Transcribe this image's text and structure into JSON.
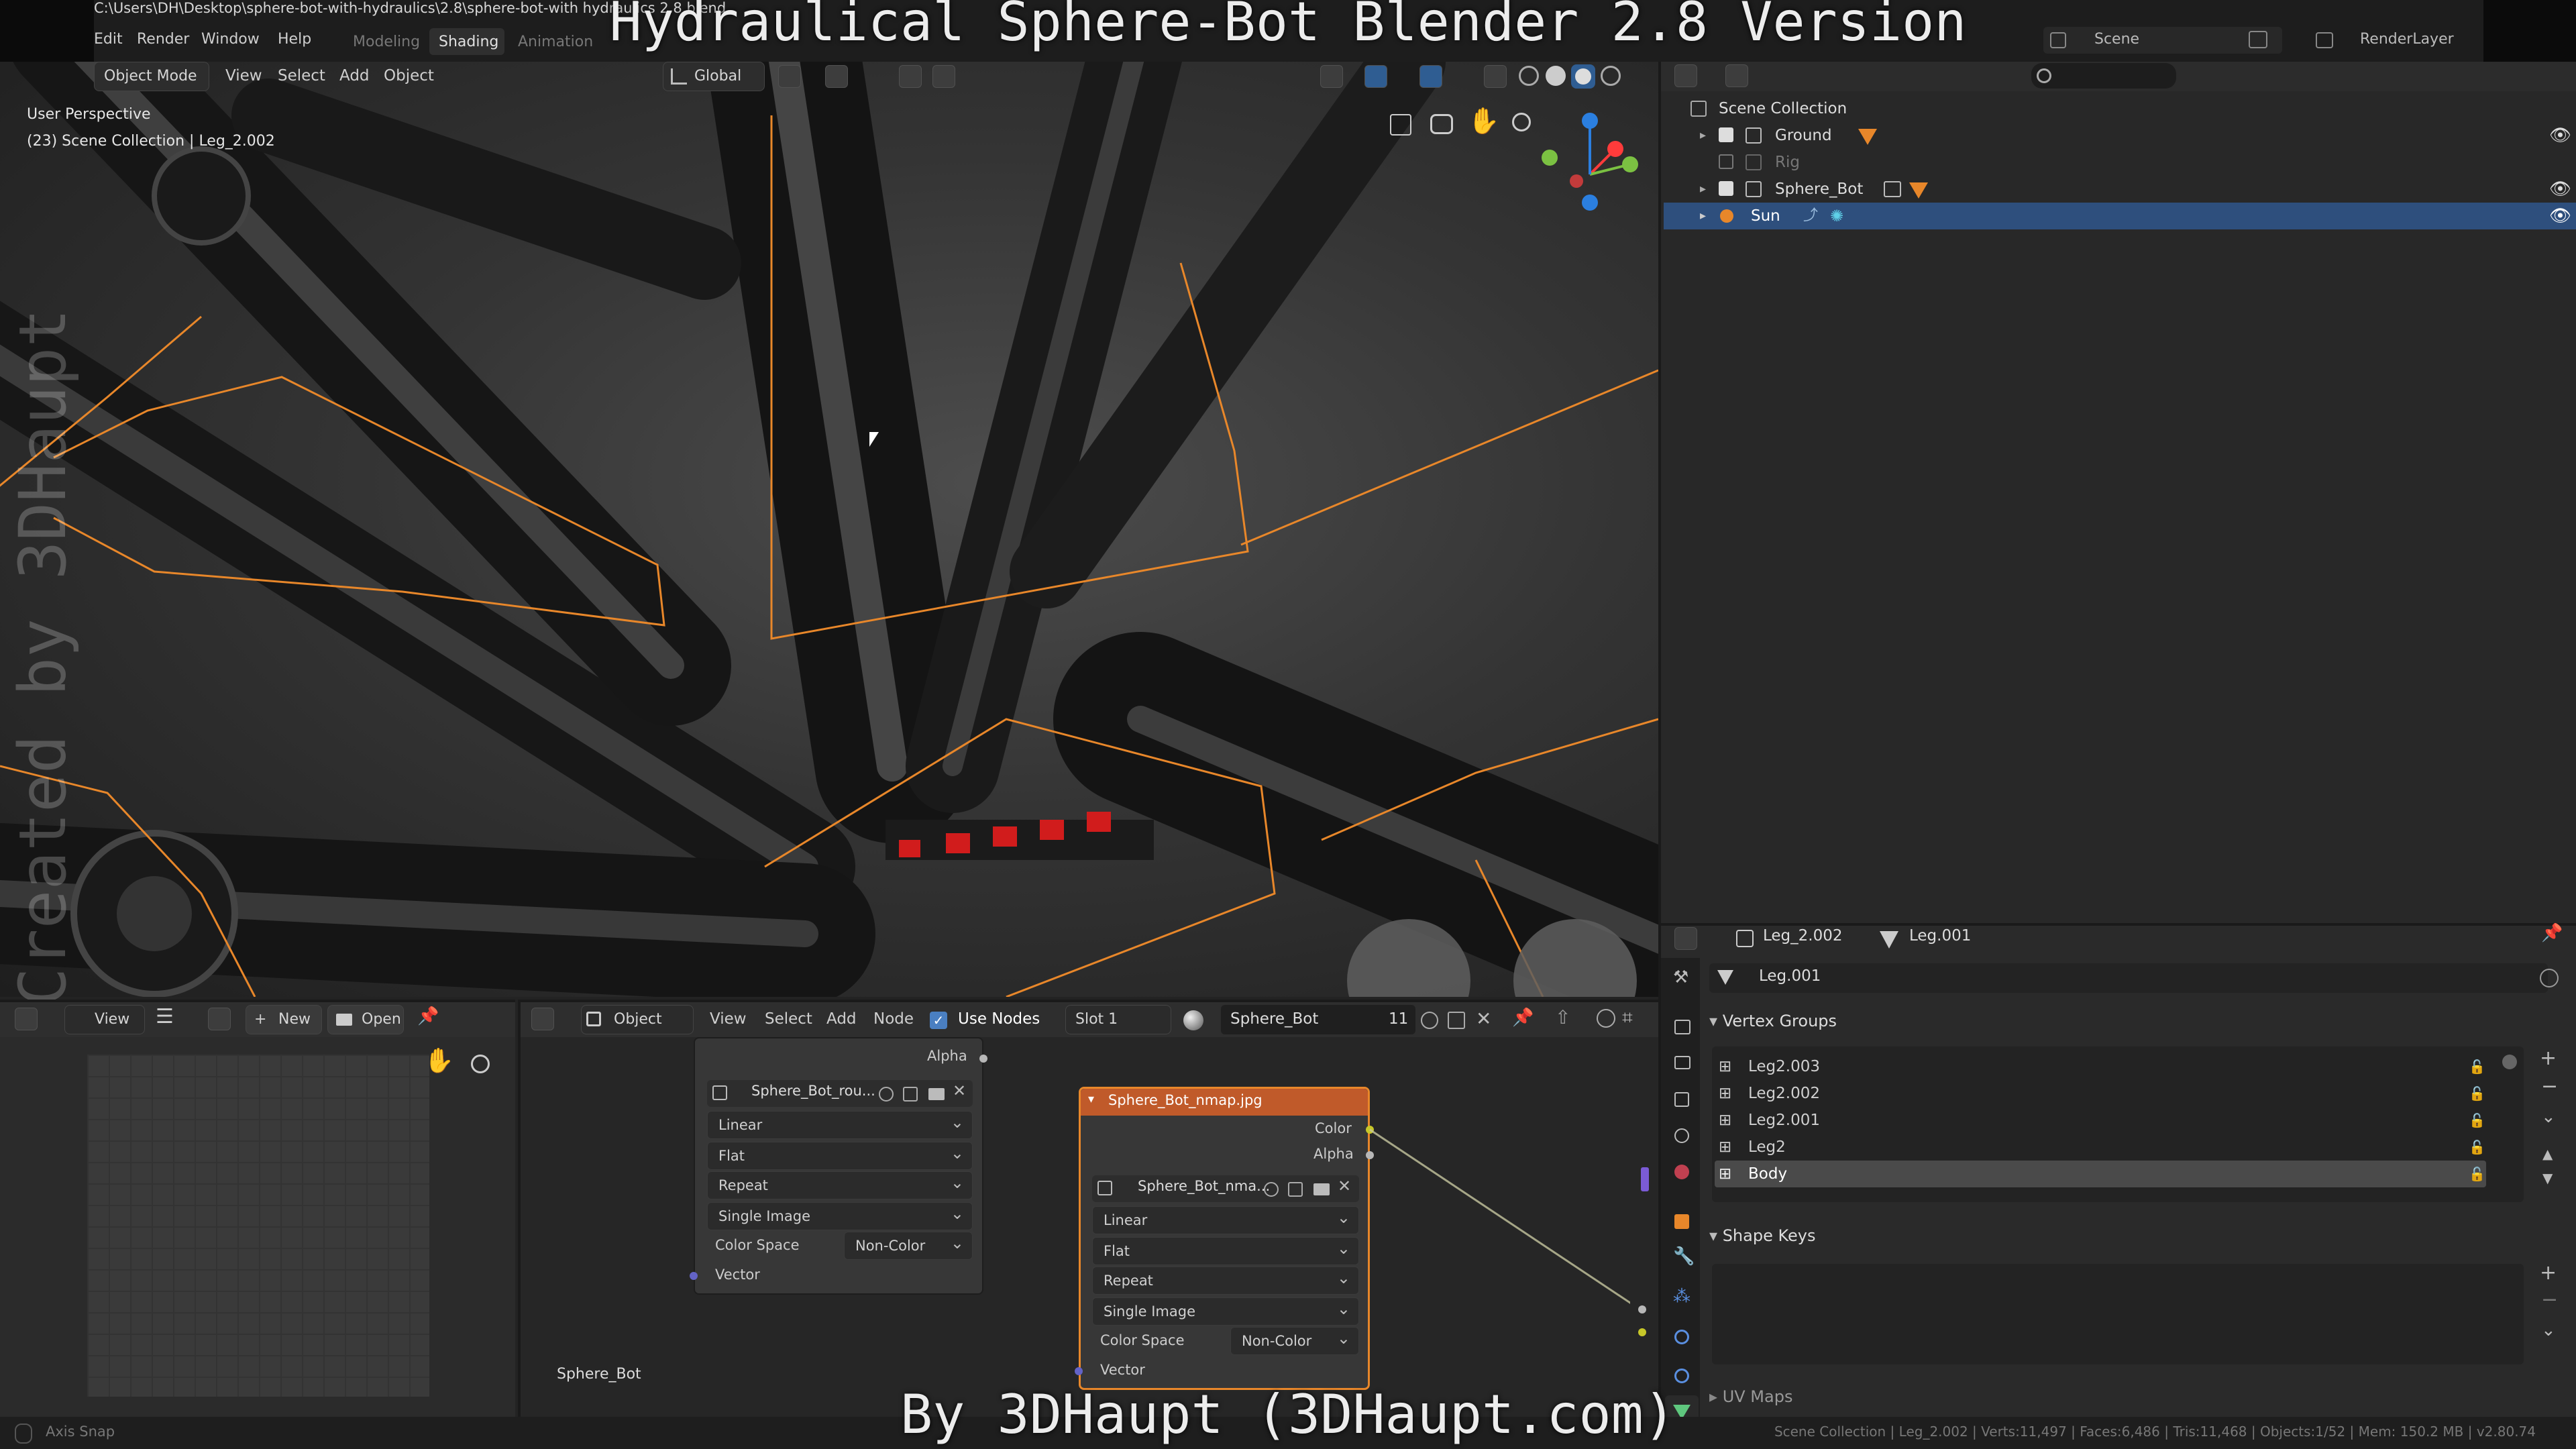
{
  "overlay": {
    "title": "Hydraulical Sphere-Bot Blender 2.8 Version",
    "byline": "By 3DHaupt (3DHaupt.com)",
    "watermark": "Created by 3DHaupt"
  },
  "topbar": {
    "filepath": "C:\\Users\\DH\\Desktop\\sphere-bot-with-hydraulics\\2.8\\sphere-bot-with hydraulics 2.8.blend",
    "menus": [
      "Edit",
      "Render",
      "Window",
      "Help"
    ],
    "workspaces": [
      "Modeling",
      "Shading",
      "Animation"
    ],
    "active_workspace": "Shading",
    "scene": "Scene",
    "render_layer": "RenderLayer"
  },
  "viewport": {
    "mode": "Object Mode",
    "menus": [
      "View",
      "Select",
      "Add",
      "Object"
    ],
    "orientation": "Global",
    "perspective": "User Perspective",
    "info": "(23) Scene Collection | Leg_2.002"
  },
  "outliner": {
    "root": "Scene Collection",
    "items": [
      {
        "label": "Ground",
        "checked": true,
        "visible": true
      },
      {
        "label": "Rig",
        "checked": false,
        "visible": false
      },
      {
        "label": "Sphere_Bot",
        "checked": true,
        "visible": true
      },
      {
        "label": "Sun",
        "checked": false,
        "visible": true,
        "selected": true
      }
    ]
  },
  "properties": {
    "object": "Leg_2.002",
    "mesh": "Leg.001",
    "mesh_field": "Leg.001",
    "vertex_groups_title": "Vertex Groups",
    "vertex_groups": [
      "Leg2.003",
      "Leg2.002",
      "Leg2.001",
      "Leg2",
      "Body"
    ],
    "active_vertex_group": "Body",
    "shape_keys_title": "Shape Keys",
    "uv_maps_title": "UV Maps"
  },
  "image_editor": {
    "view": "View",
    "new": "New",
    "open": "Open"
  },
  "node_editor": {
    "object": "Object",
    "menus": [
      "View",
      "Select",
      "Add",
      "Node"
    ],
    "use_nodes": "Use Nodes",
    "slot": "Slot 1",
    "material": "Sphere_Bot",
    "users": "11",
    "bottom_label": "Sphere_Bot",
    "node1": {
      "alpha": "Alpha",
      "image": "Sphere_Bot_rou...",
      "interpolation": "Linear",
      "projection": "Flat",
      "extension": "Repeat",
      "source": "Single Image",
      "color_space_label": "Color Space",
      "color_space": "Non-Color",
      "vector": "Vector"
    },
    "node2": {
      "title": "Sphere_Bot_nmap.jpg",
      "out_color": "Color",
      "out_alpha": "Alpha",
      "image": "Sphere_Bot_nma...",
      "interpolation": "Linear",
      "projection": "Flat",
      "extension": "Repeat",
      "source": "Single Image",
      "color_space_label": "Color Space",
      "color_space": "Non-Color",
      "vector": "Vector"
    }
  },
  "statusbar": {
    "left": "Axis Snap",
    "right": "Scene Collection | Leg_2.002 | Verts:11,497 | Faces:6,486 | Tris:11,468 | Objects:1/52 | Mem: 150.2 MB | v2.80.74"
  },
  "colors": {
    "accent_orange": "#e8872a",
    "selection_blue": "#2e4f7d",
    "node_header": "#c05a2a"
  }
}
